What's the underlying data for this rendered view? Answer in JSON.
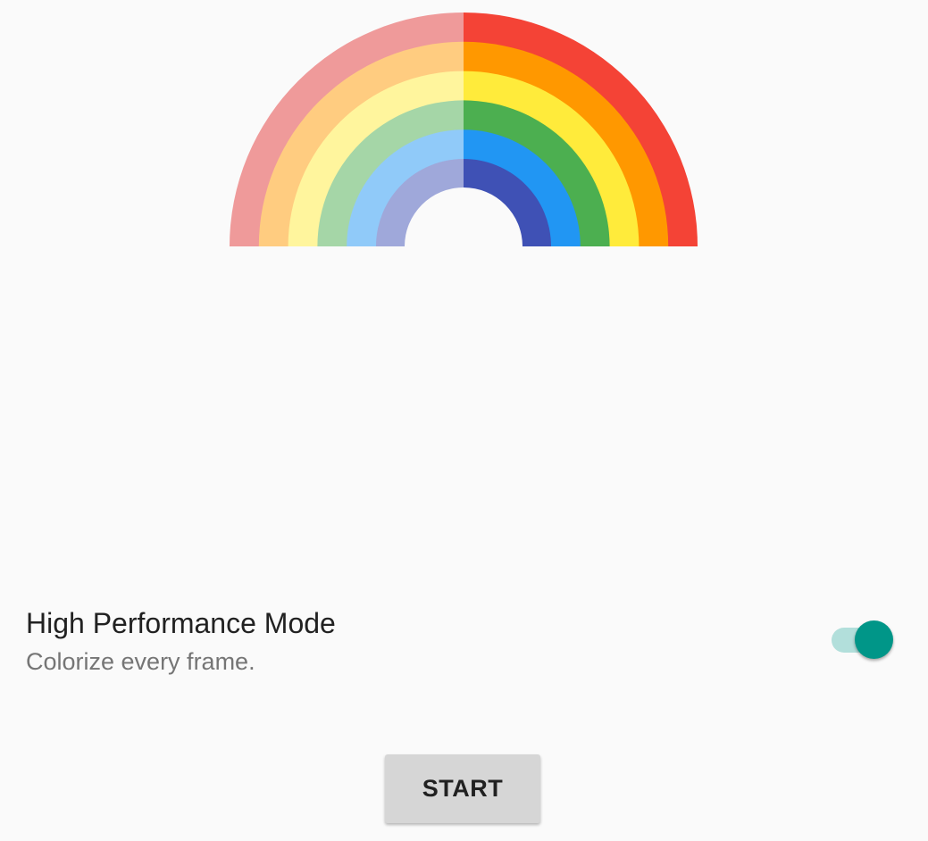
{
  "rainbow": {
    "bands_left": [
      "#ef9a9a",
      "#ffcc80",
      "#fff59d",
      "#a5d6a7",
      "#90caf9",
      "#9fa8da"
    ],
    "bands_right": [
      "#f44336",
      "#ff9800",
      "#ffeb3b",
      "#4caf50",
      "#2196f3",
      "#3f51b5"
    ],
    "background": "#fafafa"
  },
  "setting": {
    "title": "High Performance Mode",
    "subtitle": "Colorize every frame.",
    "enabled": true,
    "accent_color": "#009688",
    "track_color": "#b2dfdb"
  },
  "start_button": {
    "label": "START"
  }
}
